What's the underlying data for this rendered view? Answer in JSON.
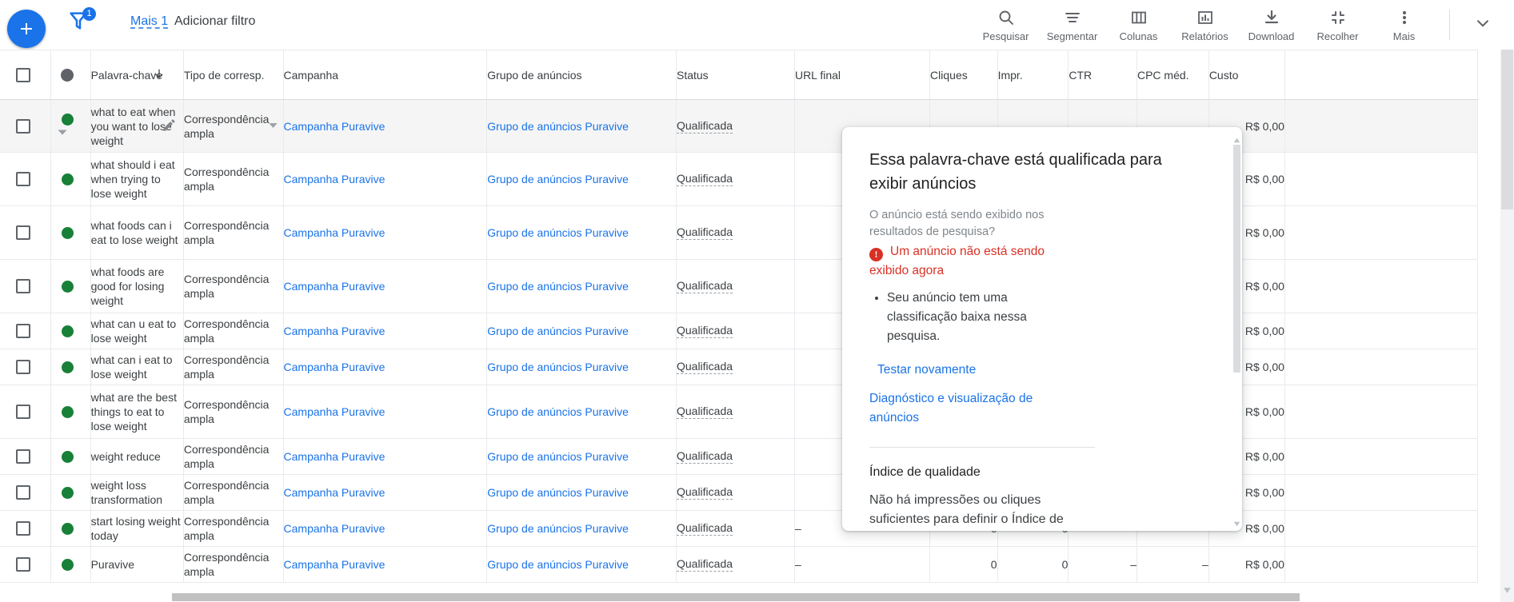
{
  "toolbar": {
    "add_button_icon": "plus-icon",
    "filter_icon": "filter-icon",
    "filter_badge_count": "1",
    "more_filters_label": "Mais 1",
    "add_filter_label": "Adicionar filtro",
    "actions": [
      {
        "label": "Pesquisar",
        "icon": "search-icon"
      },
      {
        "label": "Segmentar",
        "icon": "segment-icon"
      },
      {
        "label": "Colunas",
        "icon": "columns-icon"
      },
      {
        "label": "Relatórios",
        "icon": "reports-icon"
      },
      {
        "label": "Download",
        "icon": "download-icon"
      },
      {
        "label": "Recolher",
        "icon": "collapse-icon"
      },
      {
        "label": "Mais",
        "icon": "more-vert-icon"
      }
    ],
    "expand_chevron_icon": "chevron-down-icon"
  },
  "table": {
    "headers": {
      "checkbox": "",
      "status_dot": "",
      "keyword": "Palavra-chave",
      "sort_icon": "arrow-down-icon",
      "match_type": "Tipo de corresp.",
      "campaign": "Campanha",
      "ad_group": "Grupo de anúncios",
      "status": "Status",
      "final_url": "URL final",
      "clicks": "Cliques",
      "impressions": "Impr.",
      "ctr": "CTR",
      "avg_cpc": "CPC méd.",
      "cost": "Custo"
    },
    "rows": [
      {
        "keyword": "what to eat when you want to lose weight",
        "match_type": "Correspondência ampla",
        "campaign": "Campanha Puravive",
        "ad_group": "Grupo de anúncios Puravive",
        "status": "Qualificada",
        "final_url": "",
        "clicks": "",
        "impressions": "",
        "ctr": "–",
        "avg_cpc": "–",
        "cost": "R$ 0,00"
      },
      {
        "keyword": "what should i eat when trying to lose weight",
        "match_type": "Correspondência ampla",
        "campaign": "Campanha Puravive",
        "ad_group": "Grupo de anúncios Puravive",
        "status": "Qualificada",
        "final_url": "",
        "clicks": "",
        "impressions": "",
        "ctr": "–",
        "avg_cpc": "–",
        "cost": "R$ 0,00"
      },
      {
        "keyword": "what foods can i eat to lose weight",
        "match_type": "Correspondência ampla",
        "campaign": "Campanha Puravive",
        "ad_group": "Grupo de anúncios Puravive",
        "status": "Qualificada",
        "final_url": "",
        "clicks": "",
        "impressions": "",
        "ctr": "–",
        "avg_cpc": "–",
        "cost": "R$ 0,00"
      },
      {
        "keyword": "what foods are good for losing weight",
        "match_type": "Correspondência ampla",
        "campaign": "Campanha Puravive",
        "ad_group": "Grupo de anúncios Puravive",
        "status": "Qualificada",
        "final_url": "",
        "clicks": "",
        "impressions": "",
        "ctr": "–",
        "avg_cpc": "–",
        "cost": "R$ 0,00"
      },
      {
        "keyword": "what can u eat to lose weight",
        "match_type": "Correspondência ampla",
        "campaign": "Campanha Puravive",
        "ad_group": "Grupo de anúncios Puravive",
        "status": "Qualificada",
        "final_url": "",
        "clicks": "",
        "impressions": "",
        "ctr": "–",
        "avg_cpc": "–",
        "cost": "R$ 0,00"
      },
      {
        "keyword": "what can i eat to lose weight",
        "match_type": "Correspondência ampla",
        "campaign": "Campanha Puravive",
        "ad_group": "Grupo de anúncios Puravive",
        "status": "Qualificada",
        "final_url": "",
        "clicks": "",
        "impressions": "",
        "ctr": "–",
        "avg_cpc": "–",
        "cost": "R$ 0,00"
      },
      {
        "keyword": "what are the best things to eat to lose weight",
        "match_type": "Correspondência ampla",
        "campaign": "Campanha Puravive",
        "ad_group": "Grupo de anúncios Puravive",
        "status": "Qualificada",
        "final_url": "",
        "clicks": "",
        "impressions": "",
        "ctr": "–",
        "avg_cpc": "–",
        "cost": "R$ 0,00"
      },
      {
        "keyword": "weight reduce",
        "match_type": "Correspondência ampla",
        "campaign": "Campanha Puravive",
        "ad_group": "Grupo de anúncios Puravive",
        "status": "Qualificada",
        "final_url": "",
        "clicks": "",
        "impressions": "",
        "ctr": "–",
        "avg_cpc": "–",
        "cost": "R$ 0,00"
      },
      {
        "keyword": "weight loss transformation",
        "match_type": "Correspondência ampla",
        "campaign": "Campanha Puravive",
        "ad_group": "Grupo de anúncios Puravive",
        "status": "Qualificada",
        "final_url": "",
        "clicks": "",
        "impressions": "",
        "ctr": "–",
        "avg_cpc": "–",
        "cost": "R$ 0,00"
      },
      {
        "keyword": "start losing weight today",
        "match_type": "Correspondência ampla",
        "campaign": "Campanha Puravive",
        "ad_group": "Grupo de anúncios Puravive",
        "status": "Qualificada",
        "final_url": "–",
        "clicks": "0",
        "impressions": "0",
        "ctr": "–",
        "avg_cpc": "–",
        "cost": "R$ 0,00"
      },
      {
        "keyword": "Puravive",
        "match_type": "Correspondência ampla",
        "campaign": "Campanha Puravive",
        "ad_group": "Grupo de anúncios Puravive",
        "status": "Qualificada",
        "final_url": "–",
        "clicks": "0",
        "impressions": "0",
        "ctr": "–",
        "avg_cpc": "–",
        "cost": "R$ 0,00"
      }
    ]
  },
  "popup": {
    "title": "Essa palavra-chave está qualificada para exibir anúncios",
    "question": "O anúncio está sendo exibido nos resultados de pesquisa?",
    "alert_icon": "error-icon",
    "alert_text": "Um anúncio não está sendo exibido agora",
    "bullets": [
      "Seu anúncio tem uma classificação baixa nessa pesquisa."
    ],
    "retest_link": "Testar novamente",
    "diagnostics_link": "Diagnóstico e visualização de anúncios",
    "section_title": "Índice de qualidade",
    "section_body": "Não há impressões ou cliques suficientes para definir o Índice de"
  },
  "colors": {
    "accent_blue": "#1a73e8",
    "status_green": "#188038",
    "alert_red": "#d93025",
    "text_primary": "#3c4043",
    "border": "#e8eaed"
  }
}
